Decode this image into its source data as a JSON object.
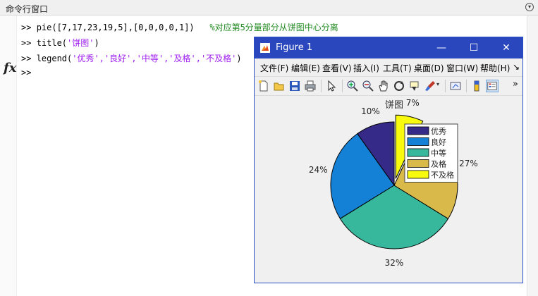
{
  "command_window": {
    "title": "命令行窗口",
    "lines": [
      {
        "prompt": ">>",
        "code": "pie([7,17,23,19,5],[0,0,0,0,1])",
        "comment": "%对应第5分量部分从饼图中心分离"
      },
      {
        "prompt": ">>",
        "code_pre": "title(",
        "str": "'饼图'",
        "code_post": ")"
      },
      {
        "prompt": ">>",
        "code_pre": "legend(",
        "str": "'优秀','良好','中等','及格','不及格'",
        "code_post": ")"
      },
      {
        "prompt": ">>"
      }
    ],
    "fx_label": "fx"
  },
  "figure": {
    "title": "Figure 1",
    "menu": [
      "文件(F)",
      "编辑(E)",
      "查看(V)",
      "插入(I)",
      "工具(T)",
      "桌面(D)",
      "窗口(W)",
      "帮助(H)"
    ],
    "window_buttons": {
      "minimize": "—",
      "maximize": "☐",
      "close": "✕"
    },
    "more_menu": "↘",
    "more_toolbar": "»"
  },
  "chart_data": {
    "type": "pie",
    "title": "饼图",
    "categories": [
      "优秀",
      "良好",
      "中等",
      "及格",
      "不及格"
    ],
    "values": [
      7,
      17,
      23,
      19,
      5
    ],
    "explode": [
      0,
      0,
      0,
      0,
      1
    ],
    "labels": [
      "10%",
      "24%",
      "32%",
      "27%",
      "7%"
    ],
    "colors": [
      "#352a87",
      "#1481d6",
      "#37b89d",
      "#d9b94a",
      "#f9fb0e"
    ],
    "legend_placement": "top-right"
  }
}
